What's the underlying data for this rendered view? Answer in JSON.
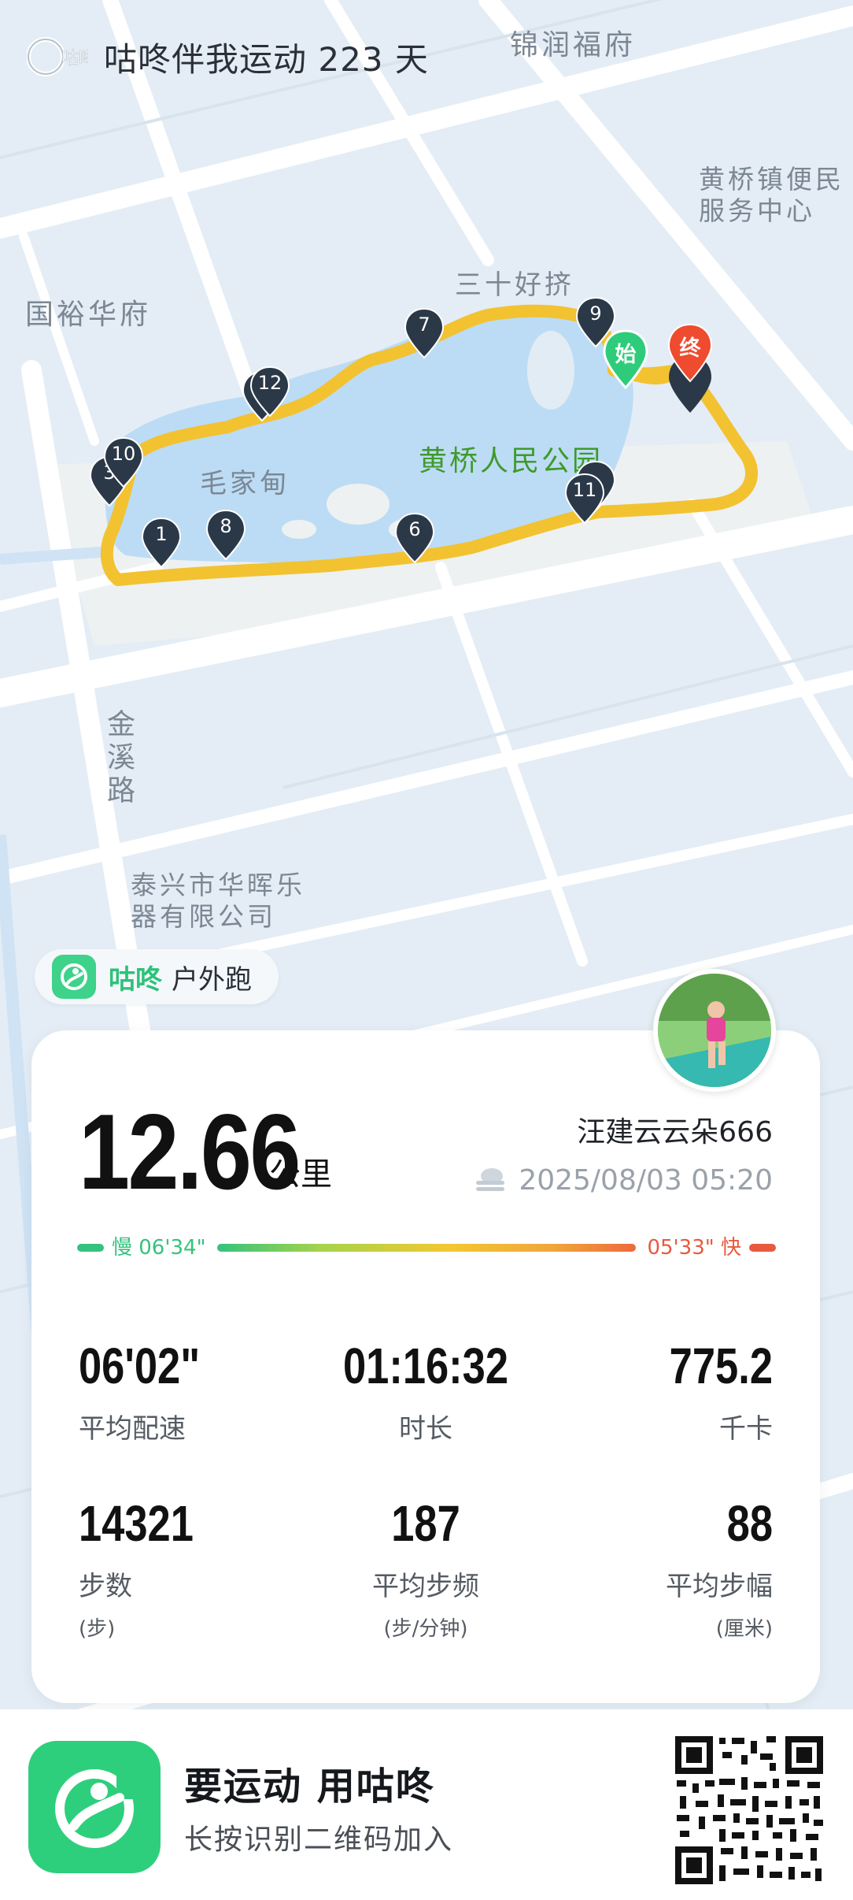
{
  "banner": {
    "logo_text": "咕咚",
    "text": "咕咚伴我运动 223 天"
  },
  "map": {
    "labels": {
      "jinrun": "锦润福府",
      "huangqiao_service": "黄桥镇便民\n服务中心",
      "guoyu": "国裕华府",
      "sanshi": "三十好挤",
      "maojiadian": "毛家甸",
      "park": "黄桥人民公园",
      "jinxi": "金溪路",
      "company": "泰兴市华晖乐\n器有限公司"
    },
    "km_markers": [
      "1",
      "3",
      "6",
      "7",
      "8",
      "9",
      "10",
      "11",
      "12"
    ],
    "start_label": "始",
    "end_label": "终",
    "colors": {
      "route": "#f2c231",
      "water": "#bcdcf5",
      "park": "#edf2f2",
      "road": "#ffffff",
      "km_pin": "#2b3848",
      "start_pin": "#2ecc7a",
      "end_pin": "#ee4b2f"
    }
  },
  "app_badge": {
    "icon": "gudong-logo-icon",
    "brand": "咕咚",
    "sport": "户外跑"
  },
  "stats": {
    "distance": "12.66",
    "distance_unit": "公里",
    "username": "汪建云云朵666",
    "weather_icon": "cloudy-icon",
    "datetime": "2025/08/03 05:20",
    "pace_slow": "慢 06'34\"",
    "pace_fast": "05'33\" 快",
    "items": [
      {
        "value": "06'02\"",
        "label": "平均配速",
        "sub": ""
      },
      {
        "value": "01:16:32",
        "label": "时长",
        "sub": ""
      },
      {
        "value": "775.2",
        "label": "千卡",
        "sub": ""
      },
      {
        "value": "14321",
        "label": "步数",
        "sub": "(步)"
      },
      {
        "value": "187",
        "label": "平均步频",
        "sub": "(步/分钟)"
      },
      {
        "value": "88",
        "label": "平均步幅",
        "sub": "(厘米)"
      }
    ],
    "colors": {
      "slow": "#35c27e",
      "fast": "#e85a40"
    }
  },
  "footer": {
    "title": "要运动 用咕咚",
    "subtitle": "长按识别二维码加入"
  }
}
